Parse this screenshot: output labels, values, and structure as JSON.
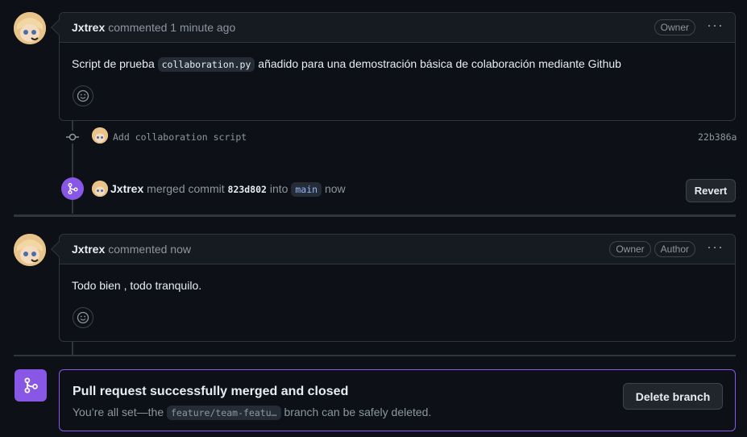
{
  "comment1": {
    "author": "Jxtrex",
    "time": "commented 1 minute ago",
    "badge_owner": "Owner",
    "body_prefix": "Script de prueba",
    "body_code": "collaboration.py",
    "body_suffix": "añadido para una demostración básica de colaboración mediante Github"
  },
  "commit_event": {
    "message": "Add collaboration script",
    "sha": "22b386a"
  },
  "merge_event": {
    "author": "Jxtrex",
    "text1": "merged commit",
    "sha": "823d802",
    "text2": "into",
    "branch": "main",
    "time": "now",
    "revert_label": "Revert"
  },
  "comment2": {
    "author": "Jxtrex",
    "time": "commented now",
    "badge_owner": "Owner",
    "badge_author": "Author",
    "body": "Todo bien , todo tranquilo."
  },
  "merged_box": {
    "title": "Pull request successfully merged and closed",
    "text_prefix": "You’re all set—the",
    "branch": "feature/team-featu…",
    "text_suffix": "branch can be safely deleted.",
    "delete_label": "Delete branch"
  },
  "colors": {
    "accent_purple": "#8957e5",
    "border": "#30363d",
    "background": "#0d1117"
  },
  "icons": [
    "avatar",
    "kebab-icon",
    "smiley-icon",
    "git-commit-icon",
    "git-merge-icon"
  ]
}
